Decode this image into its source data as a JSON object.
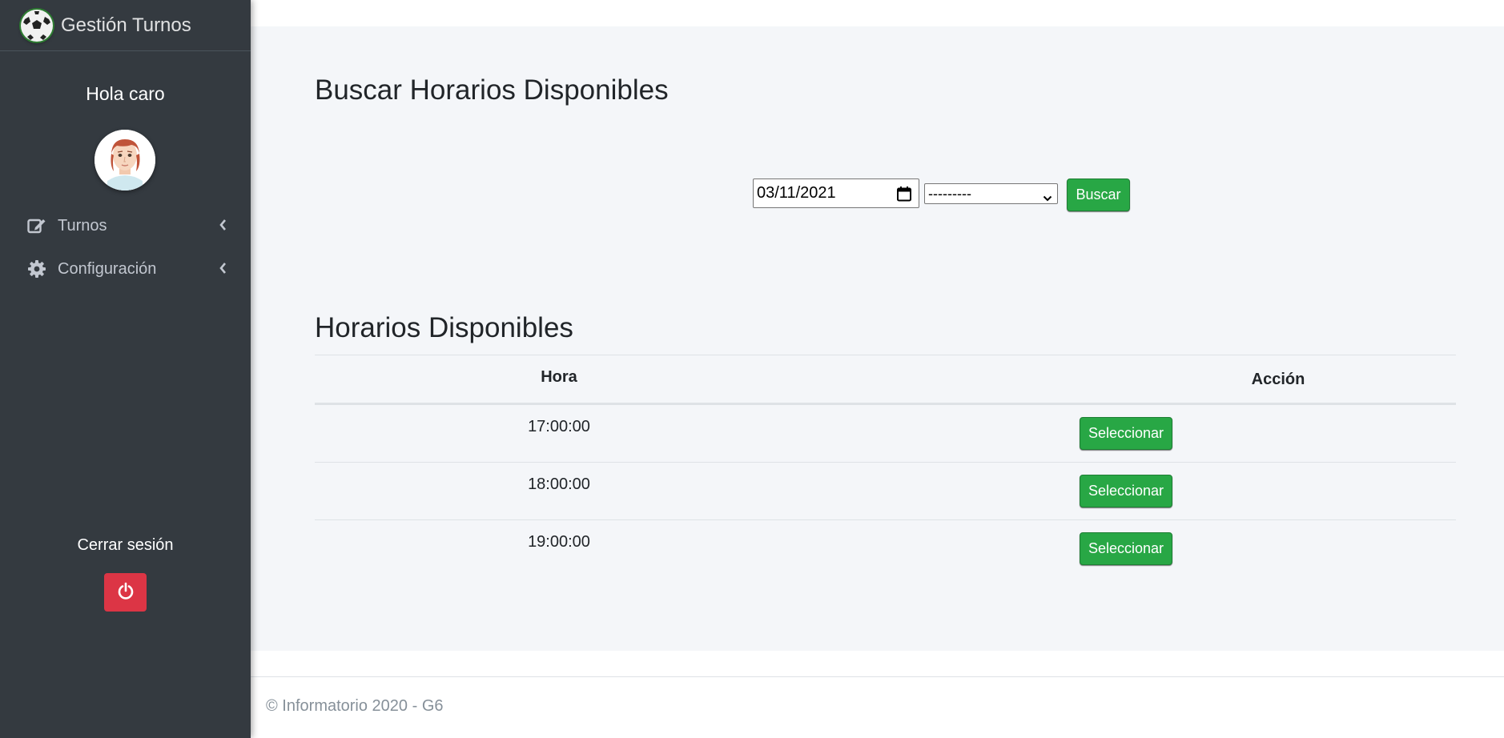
{
  "brand": {
    "title": "Gestión Turnos"
  },
  "sidebar": {
    "greeting": "Hola caro",
    "items": [
      {
        "label": "Turnos",
        "icon": "edit-icon"
      },
      {
        "label": "Configuración",
        "icon": "gear-icon"
      }
    ],
    "logout_label": "Cerrar sesión"
  },
  "search": {
    "title": "Buscar Horarios Disponibles",
    "date_value": "03/11/2021",
    "select_value": "---------",
    "button_label": "Buscar"
  },
  "results": {
    "title": "Horarios Disponibles",
    "columns": [
      "Hora",
      "Acción"
    ],
    "rows": [
      {
        "hora": "17:00:00",
        "action": "Seleccionar"
      },
      {
        "hora": "18:00:00",
        "action": "Seleccionar"
      },
      {
        "hora": "19:00:00",
        "action": "Seleccionar"
      }
    ]
  },
  "footer": {
    "text": "© Informatorio 2020 - G6"
  },
  "colors": {
    "sidebar_bg": "#343a40",
    "content_bg": "#f4f6f9",
    "primary_green": "#28a745",
    "danger_red": "#dc3545"
  }
}
